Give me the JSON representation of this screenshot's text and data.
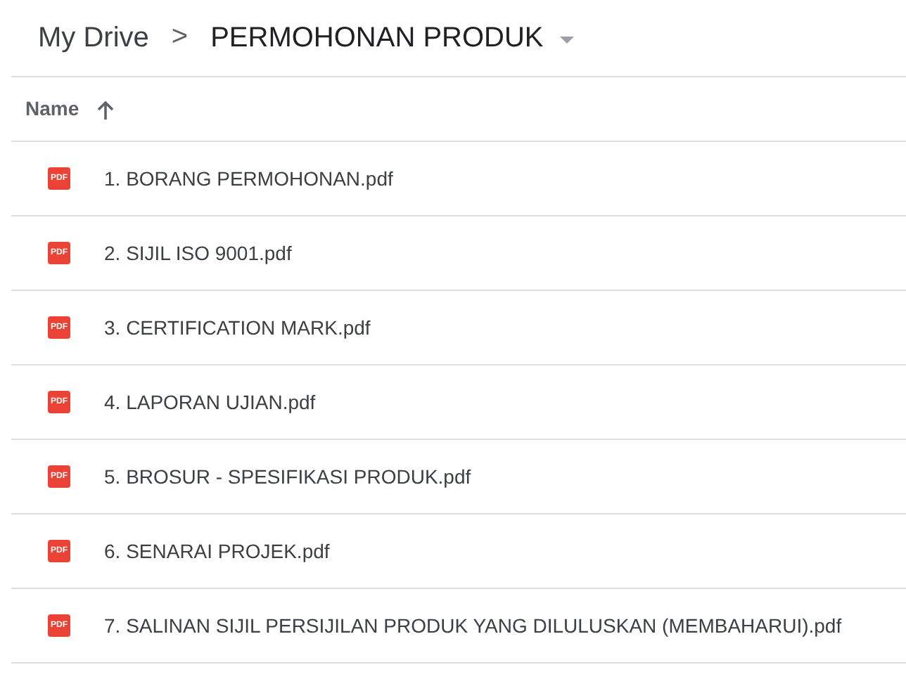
{
  "breadcrumb": {
    "items": [
      "My Drive",
      "PERMOHONAN PRODUK"
    ],
    "separator": ">"
  },
  "column_header": {
    "label": "Name",
    "sort_ascending": true
  },
  "files": [
    {
      "name": "1. BORANG PERMOHONAN.pdf",
      "icon_label": "PDF"
    },
    {
      "name": "2. SIJIL ISO 9001.pdf",
      "icon_label": "PDF"
    },
    {
      "name": "3. CERTIFICATION MARK.pdf",
      "icon_label": "PDF"
    },
    {
      "name": "4. LAPORAN UJIAN.pdf",
      "icon_label": "PDF"
    },
    {
      "name": "5. BROSUR - SPESIFIKASI PRODUK.pdf",
      "icon_label": "PDF"
    },
    {
      "name": "6. SENARAI PROJEK.pdf",
      "icon_label": "PDF"
    },
    {
      "name": "7. SALINAN SIJIL PERSIJILAN PRODUK YANG DILULUSKAN (MEMBAHARUI).pdf",
      "icon_label": "PDF"
    }
  ]
}
